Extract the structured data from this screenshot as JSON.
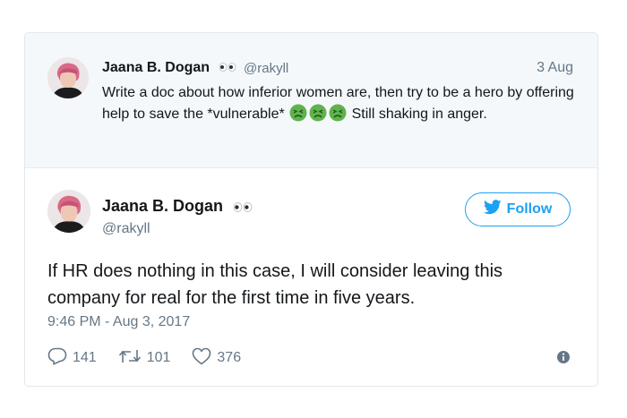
{
  "quoted_tweet": {
    "author_name": "Jaana B. Dogan",
    "author_handle": "@rakyll",
    "date": "3 Aug",
    "text_before_emoji": "Write a doc about how inferior women are, then try to be a hero by offering help to save the *vulnerable*",
    "emoji": [
      "persevering-face",
      "persevering-face",
      "persevering-face"
    ],
    "text_after_emoji": "Still shaking in anger."
  },
  "main_tweet": {
    "author_name": "Jaana B. Dogan",
    "author_handle": "@rakyll",
    "follow_label": "Follow",
    "text": "If HR does nothing in this case, I will consider leaving this company for real for the first time in five years.",
    "timestamp": "9:46 PM - Aug 3, 2017",
    "reply_count": "141",
    "retweet_count": "101",
    "like_count": "376"
  },
  "colors": {
    "accent": "#1da1f2",
    "secondary_text": "#657786",
    "quoted_background": "#f5f8fa",
    "border": "#e1e8ed",
    "emoji_green": "#5fb24c"
  },
  "icons": {
    "author_name_suffix": "eyes-icon",
    "follow": "twitter-bird-icon",
    "reply": "reply-icon",
    "retweet": "retweet-icon",
    "like": "heart-icon",
    "info": "info-icon"
  }
}
